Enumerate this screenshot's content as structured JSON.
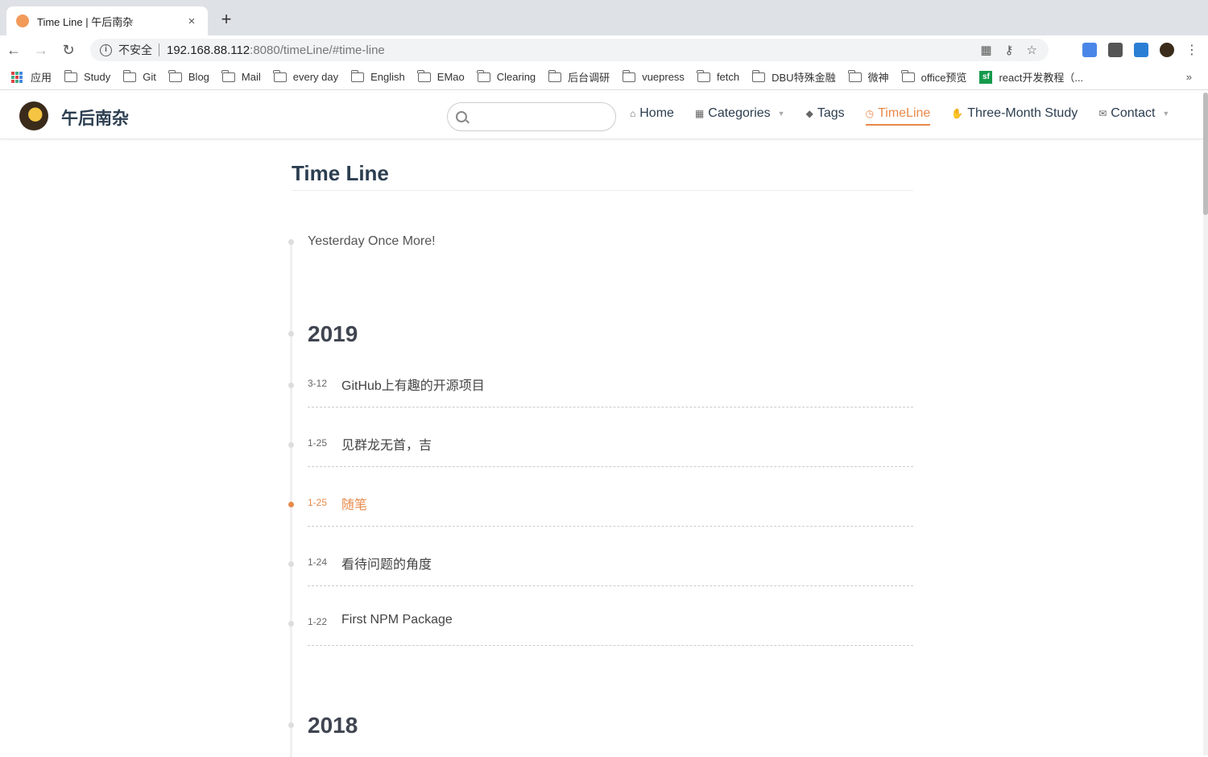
{
  "browser": {
    "tab_title": "Time Line | 午后南杂",
    "close_glyph": "×",
    "new_tab_glyph": "+",
    "insecure_label": "不安全",
    "url_host": "192.168.88.112",
    "url_rest": ":8080/timeLine/#time-line",
    "bookmarks": [
      "应用",
      "Study",
      "Git",
      "Blog",
      "Mail",
      "every day",
      "English",
      "EMao",
      "Clearing",
      "后台调研",
      "vuepress",
      "fetch",
      "DBU特殊金融",
      "微神",
      "office预览",
      "react开发教程（..."
    ],
    "bookmarks_more": "»"
  },
  "site": {
    "name": "午后南杂",
    "nav": [
      {
        "label": "Home",
        "icon": "home-icon"
      },
      {
        "label": "Categories",
        "icon": "grid-icon"
      },
      {
        "label": "Tags",
        "icon": "tag-icon"
      },
      {
        "label": "TimeLine",
        "icon": "clock-icon"
      },
      {
        "label": "Three-Month Study",
        "icon": "hand-icon"
      },
      {
        "label": "Contact",
        "icon": "message-icon"
      }
    ],
    "accent": "#e8894a"
  },
  "page": {
    "title": "Time Line",
    "intro": "Yesterday Once More!",
    "years": [
      "2019",
      "2018"
    ],
    "posts_2019": [
      {
        "date": "3-12",
        "title": "GitHub上有趣的开源项目"
      },
      {
        "date": "1-25",
        "title": "见群龙无首，吉"
      },
      {
        "date": "1-25",
        "title": "随笔"
      },
      {
        "date": "1-24",
        "title": "看待问题的角度"
      },
      {
        "date": "1-22",
        "title": "First NPM Package"
      }
    ]
  }
}
